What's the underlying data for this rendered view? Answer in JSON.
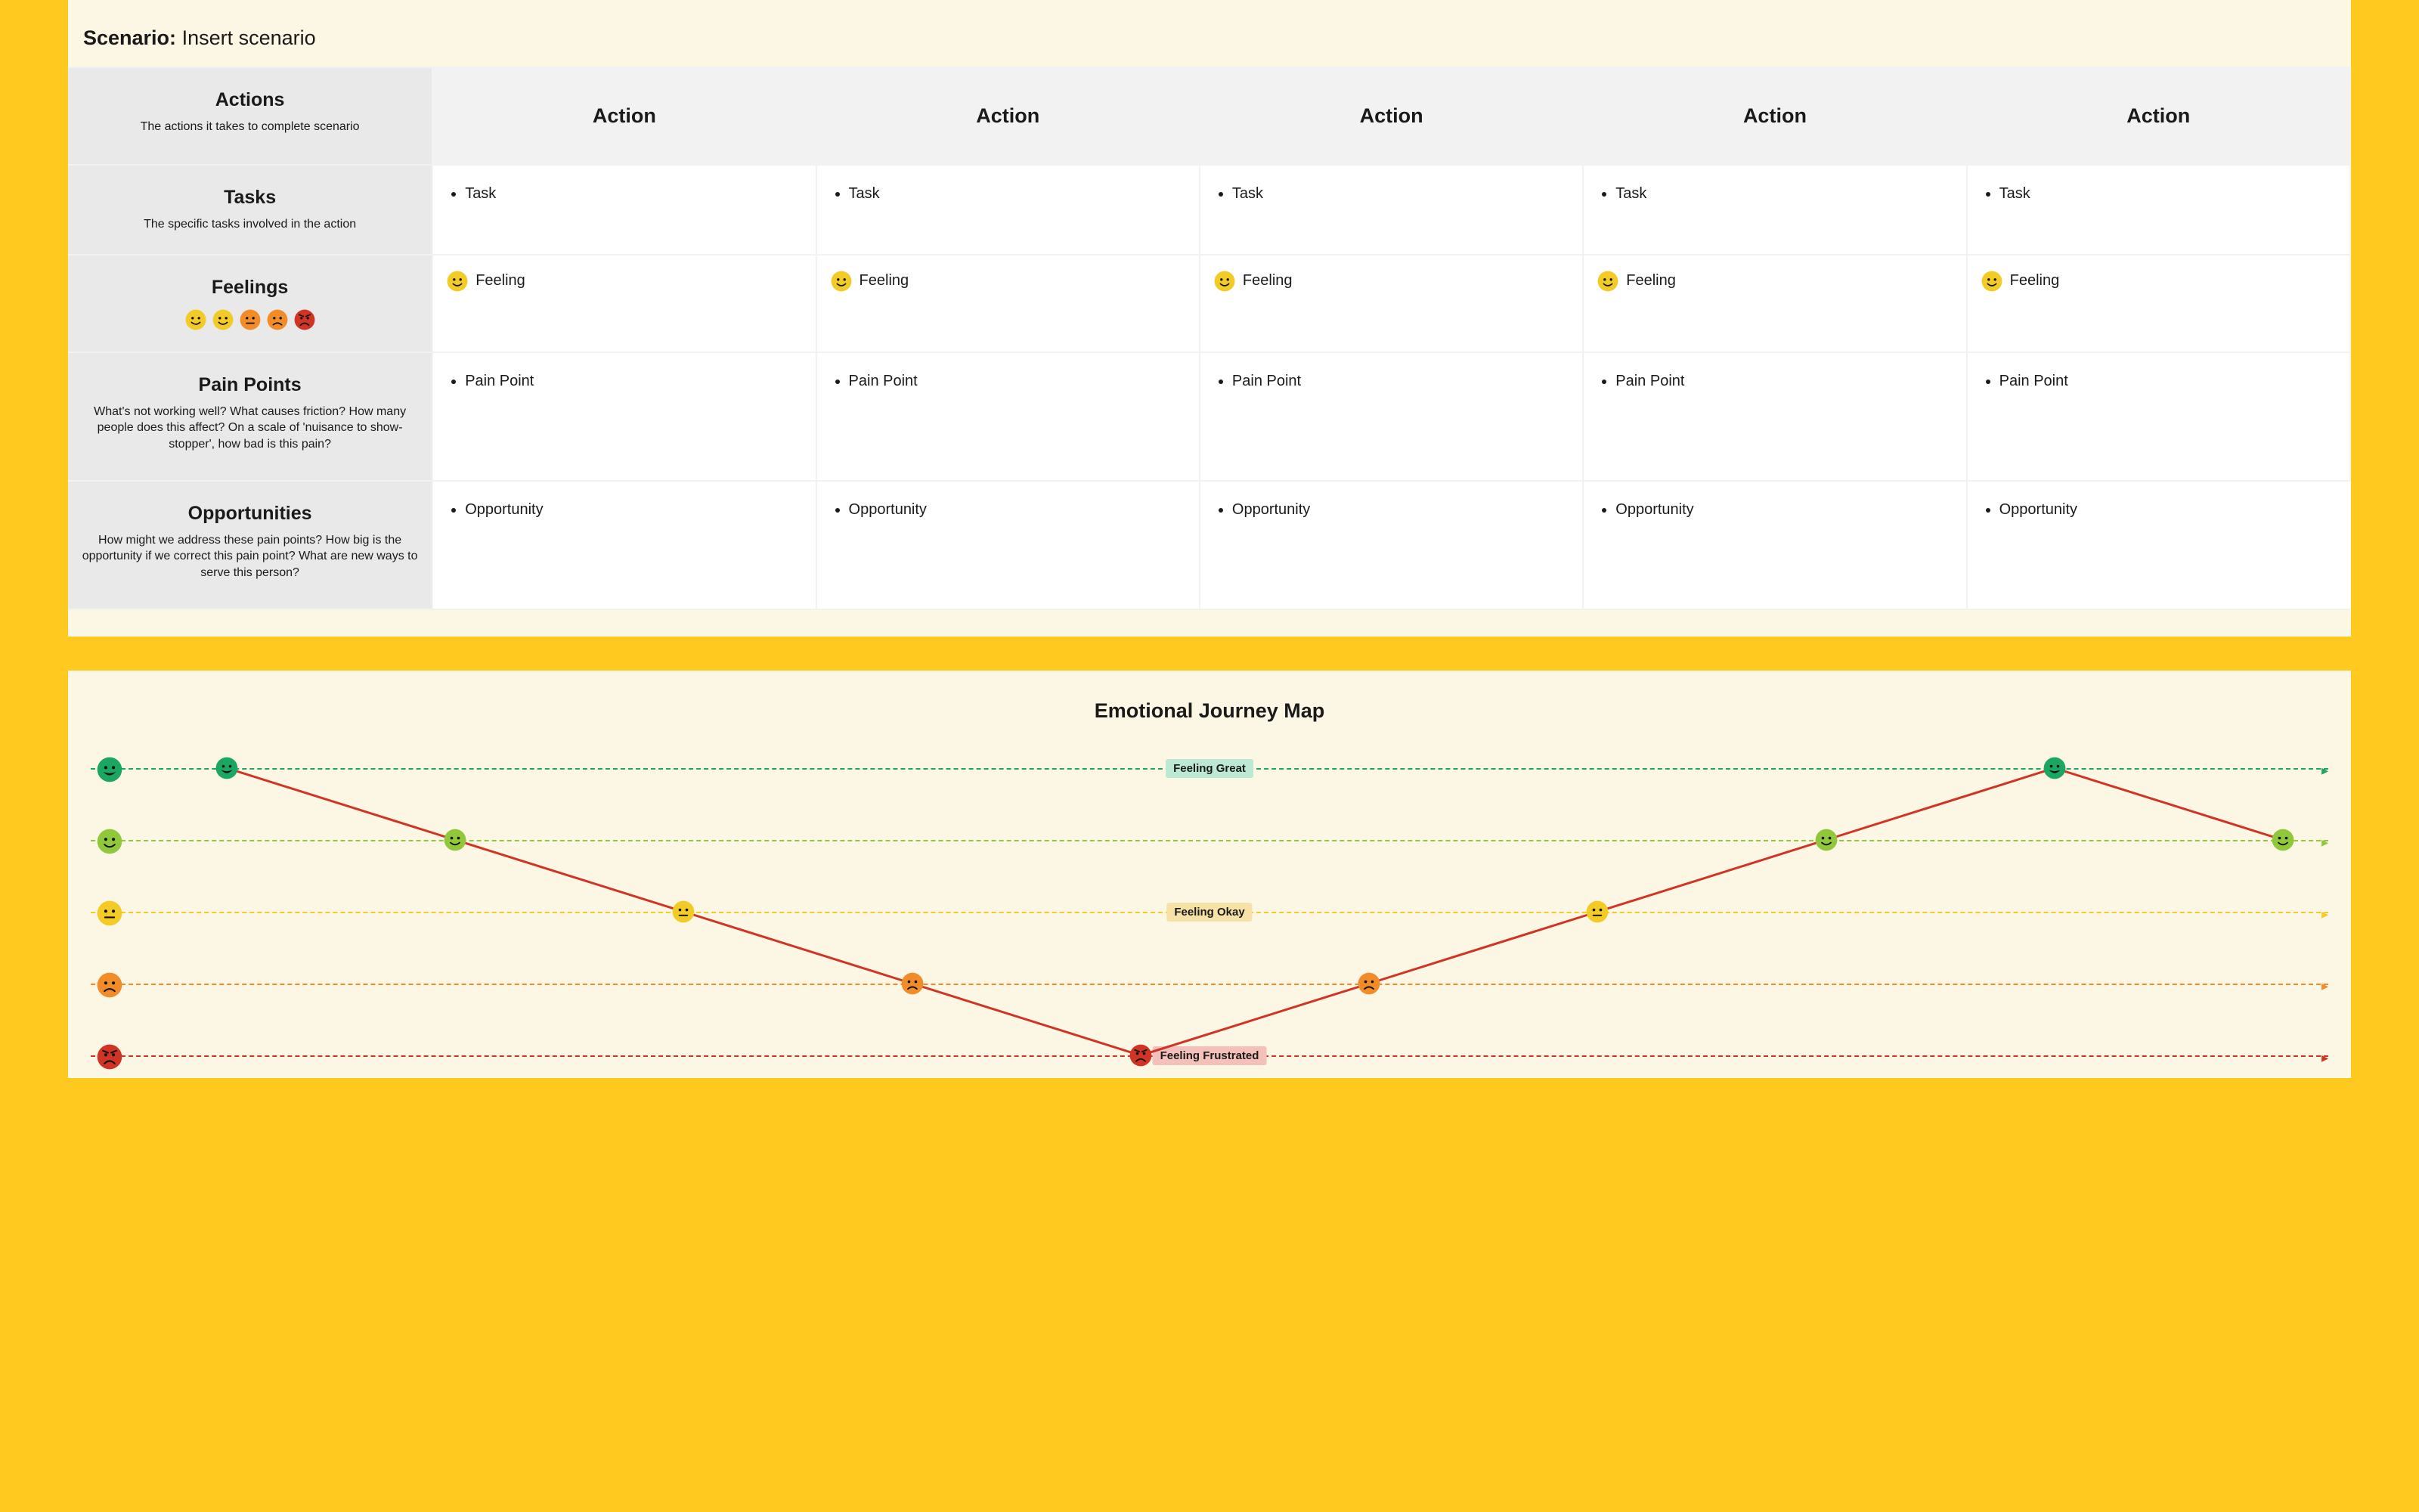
{
  "scenario": {
    "label": "Scenario:",
    "value": "Insert scenario"
  },
  "columns": [
    "Action",
    "Action",
    "Action",
    "Action",
    "Action"
  ],
  "rows": {
    "actions": {
      "title": "Actions",
      "sub": "The actions it takes to complete scenario"
    },
    "tasks": {
      "title": "Tasks",
      "sub": "The specific tasks involved in the action",
      "items": [
        "Task",
        "Task",
        "Task",
        "Task",
        "Task"
      ]
    },
    "feelings": {
      "title": "Feelings",
      "palette": [
        "great",
        "happy",
        "okay",
        "sad",
        "angry"
      ],
      "items": [
        "Feeling",
        "Feeling",
        "Feeling",
        "Feeling",
        "Feeling"
      ],
      "item_mood": "happy"
    },
    "pain": {
      "title": "Pain Points",
      "sub": "What's not working well? What causes friction? How many people does this affect? On a scale of 'nuisance to show-stopper', how bad is this pain?",
      "items": [
        "Pain Point",
        "Pain Point",
        "Pain Point",
        "Pain Point",
        "Pain Point"
      ]
    },
    "opps": {
      "title": "Opportunities",
      "sub": "How might we address these pain points? How big is the opportunity if we correct this pain point? What are new ways to serve this person?",
      "items": [
        "Opportunity",
        "Opportunity",
        "Opportunity",
        "Opportunity",
        "Opportunity"
      ]
    }
  },
  "ej": {
    "title": "Emotional Journey Map",
    "labels": {
      "great": "Feeling Great",
      "okay": "Feeling Okay",
      "angry": "Feeling Frustrated"
    }
  },
  "chart_data": {
    "type": "line",
    "title": "Emotional Journey Map",
    "y_levels": [
      {
        "id": "great",
        "value": 5,
        "label": "Feeling Great"
      },
      {
        "id": "happy",
        "value": 4,
        "label": ""
      },
      {
        "id": "okay",
        "value": 3,
        "label": "Feeling Okay"
      },
      {
        "id": "sad",
        "value": 2,
        "label": ""
      },
      {
        "id": "angry",
        "value": 1,
        "label": "Feeling Frustrated"
      }
    ],
    "x": [
      1,
      2,
      3,
      4,
      5,
      6,
      7,
      8,
      9,
      10
    ],
    "values_level": [
      "great",
      "happy",
      "okay",
      "sad",
      "angry",
      "sad",
      "okay",
      "happy",
      "great",
      "happy"
    ],
    "ylim": [
      1,
      5
    ],
    "line_color": "#D03424"
  }
}
